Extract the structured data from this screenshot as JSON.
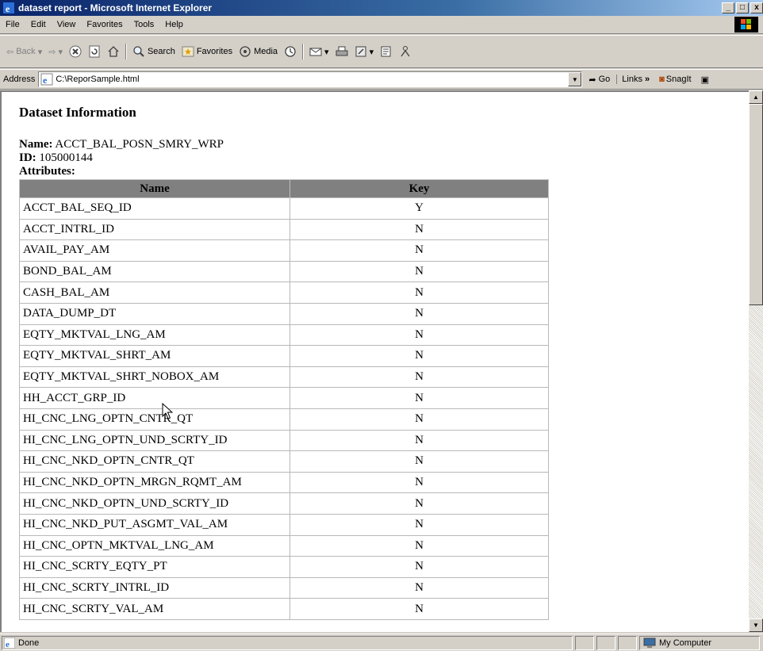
{
  "window": {
    "title": "dataset report - Microsoft Internet Explorer",
    "min_label": "_",
    "max_label": "□",
    "close_label": "x"
  },
  "menu": [
    "File",
    "Edit",
    "View",
    "Favorites",
    "Tools",
    "Help"
  ],
  "toolbar": {
    "back": "Back",
    "search": "Search",
    "favorites": "Favorites",
    "media": "Media"
  },
  "address": {
    "label": "Address",
    "url": "C:\\ReporSample.html",
    "go": "Go",
    "links": "Links",
    "snagit": "SnagIt"
  },
  "page": {
    "heading": "Dataset Information",
    "name_label": "Name:",
    "name_value": "ACCT_BAL_POSN_SMRY_WRP",
    "id_label": "ID:",
    "id_value": "105000144",
    "attributes_label": "Attributes:",
    "table": {
      "headers": [
        "Name",
        "Key"
      ],
      "rows": [
        [
          "ACCT_BAL_SEQ_ID",
          "Y"
        ],
        [
          "ACCT_INTRL_ID",
          "N"
        ],
        [
          "AVAIL_PAY_AM",
          "N"
        ],
        [
          "BOND_BAL_AM",
          "N"
        ],
        [
          "CASH_BAL_AM",
          "N"
        ],
        [
          "DATA_DUMP_DT",
          "N"
        ],
        [
          "EQTY_MKTVAL_LNG_AM",
          "N"
        ],
        [
          "EQTY_MKTVAL_SHRT_AM",
          "N"
        ],
        [
          "EQTY_MKTVAL_SHRT_NOBOX_AM",
          "N"
        ],
        [
          "HH_ACCT_GRP_ID",
          "N"
        ],
        [
          "HI_CNC_LNG_OPTN_CNTR_QT",
          "N"
        ],
        [
          "HI_CNC_LNG_OPTN_UND_SCRTY_ID",
          "N"
        ],
        [
          "HI_CNC_NKD_OPTN_CNTR_QT",
          "N"
        ],
        [
          "HI_CNC_NKD_OPTN_MRGN_RQMT_AM",
          "N"
        ],
        [
          "HI_CNC_NKD_OPTN_UND_SCRTY_ID",
          "N"
        ],
        [
          "HI_CNC_NKD_PUT_ASGMT_VAL_AM",
          "N"
        ],
        [
          "HI_CNC_OPTN_MKTVAL_LNG_AM",
          "N"
        ],
        [
          "HI_CNC_SCRTY_EQTY_PT",
          "N"
        ],
        [
          "HI_CNC_SCRTY_INTRL_ID",
          "N"
        ],
        [
          "HI_CNC_SCRTY_VAL_AM",
          "N"
        ]
      ]
    }
  },
  "status": {
    "text": "Done",
    "zone": "My Computer"
  },
  "icons": {
    "app": "ie-icon",
    "page": "ie-page-icon",
    "computer": "computer-icon"
  }
}
